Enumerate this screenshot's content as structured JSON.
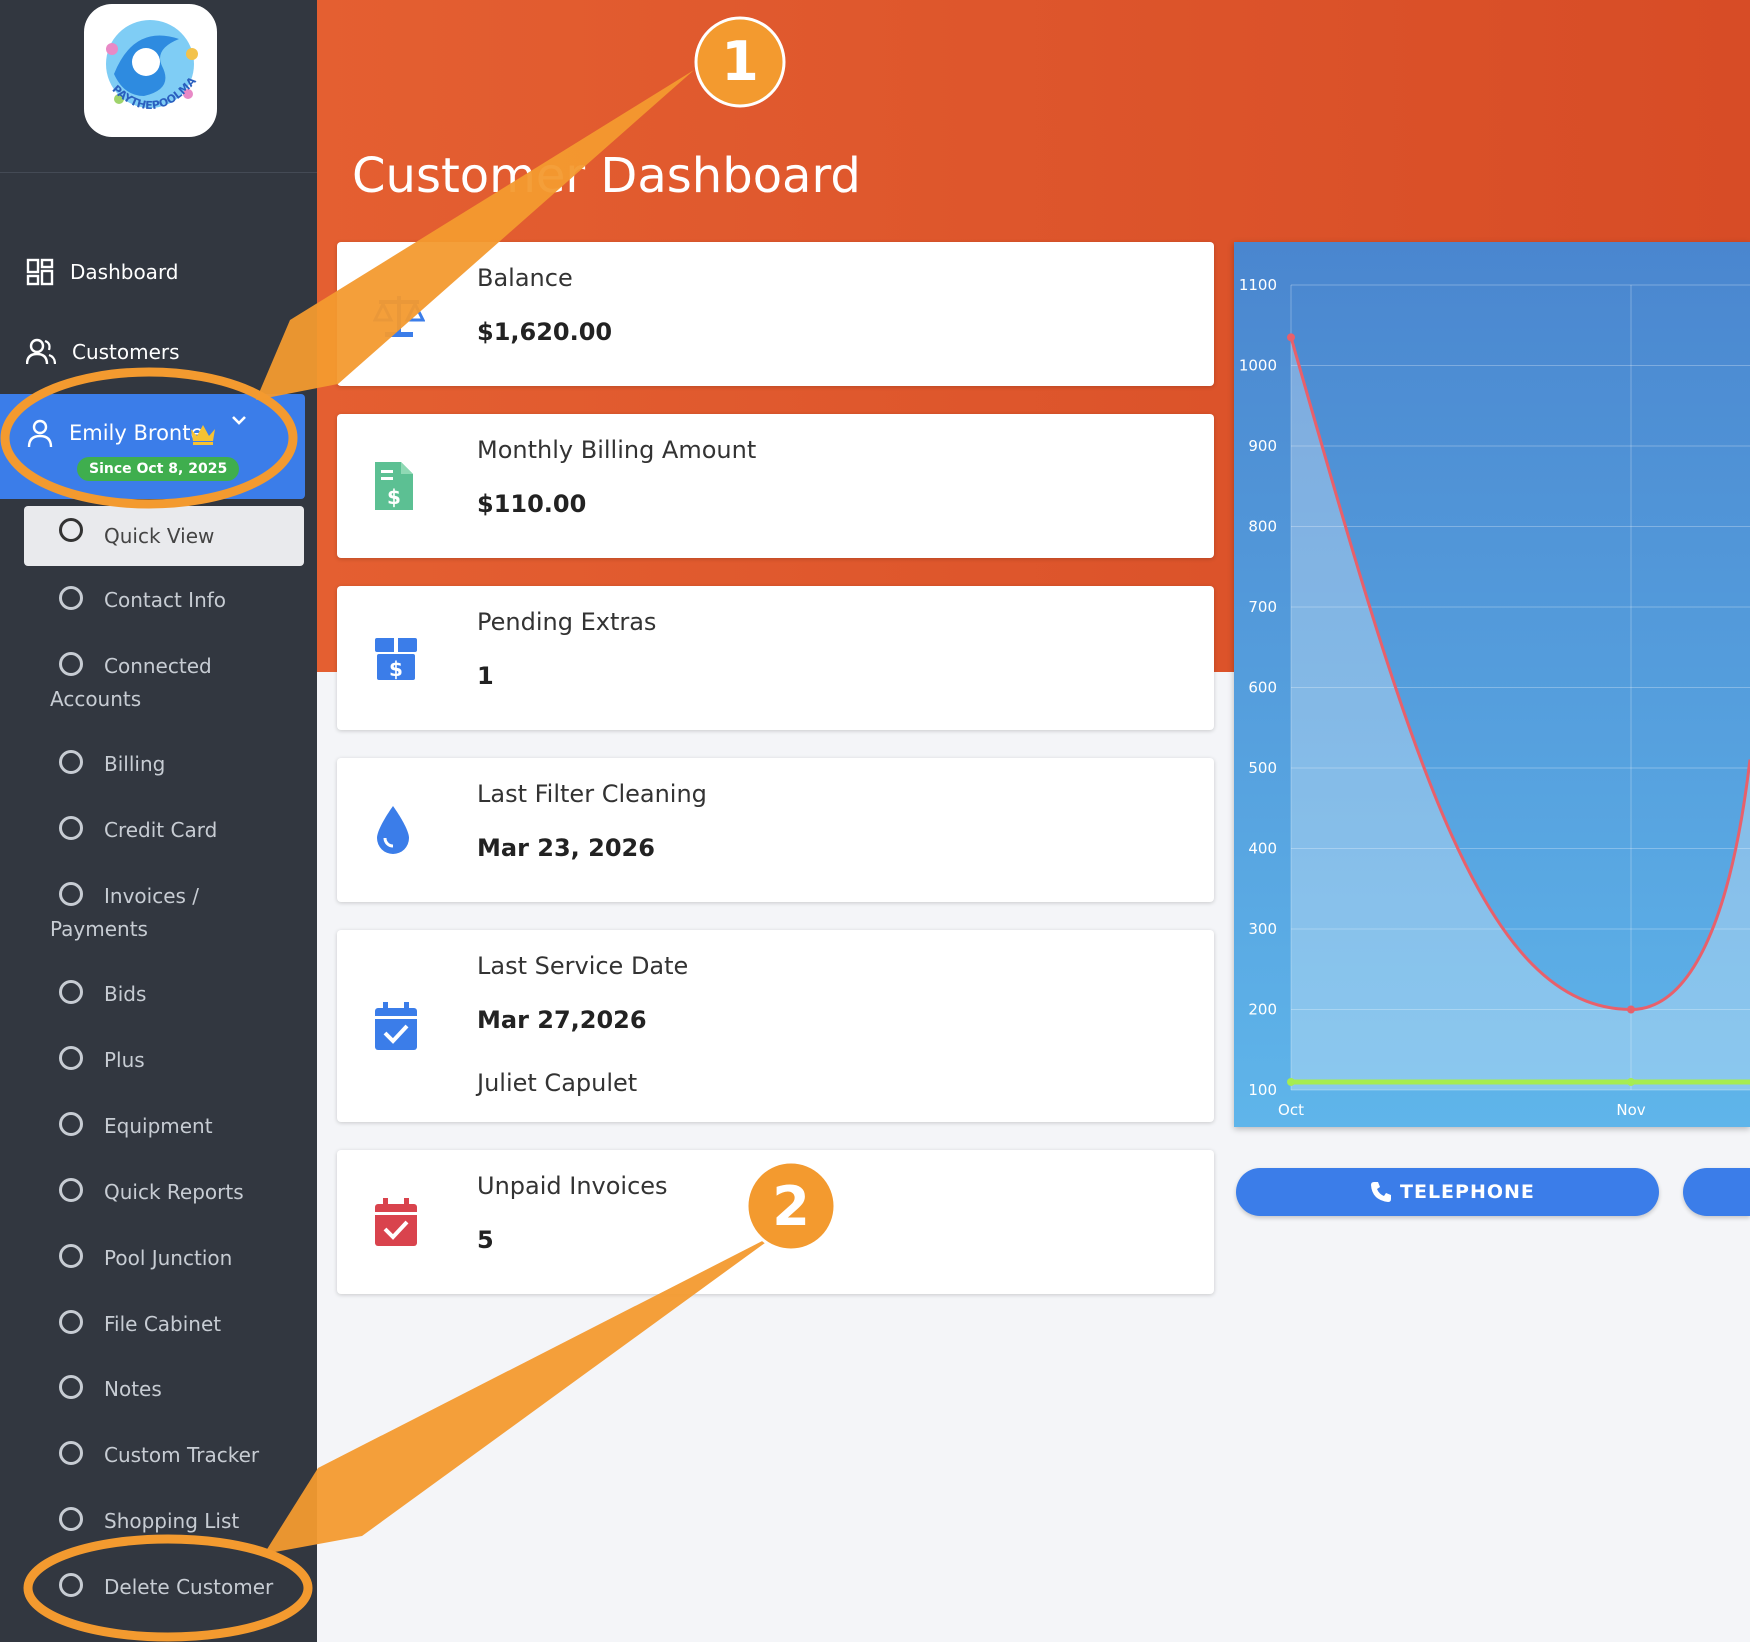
{
  "sidebar": {
    "logo_text": "PAYTHEPOOLMAN",
    "nav": [
      {
        "label": "Dashboard",
        "icon": "dashboard-grid-icon"
      },
      {
        "label": "Customers",
        "icon": "users-icon"
      }
    ],
    "customer": {
      "name": "Emily Bronte",
      "since": "Since Oct 8, 2025",
      "badge_icon": "crown-icon"
    },
    "menu": [
      {
        "label": "Quick View",
        "active": true
      },
      {
        "label": "Contact Info"
      },
      {
        "label": "Connected Accounts"
      },
      {
        "label": "Billing"
      },
      {
        "label": "Credit Card"
      },
      {
        "label": "Invoices / Payments"
      },
      {
        "label": "Bids"
      },
      {
        "label": "Plus"
      },
      {
        "label": "Equipment"
      },
      {
        "label": "Quick Reports"
      },
      {
        "label": "Pool Junction"
      },
      {
        "label": "File Cabinet"
      },
      {
        "label": "Notes"
      },
      {
        "label": "Custom Tracker"
      },
      {
        "label": "Shopping List"
      },
      {
        "label": "Delete Customer"
      }
    ]
  },
  "page": {
    "title": "Customer Dashboard"
  },
  "cards": [
    {
      "title": "Balance",
      "value": "$1,620.00",
      "icon": "scale-icon"
    },
    {
      "title": "Monthly Billing Amount",
      "value": "$110.00",
      "icon": "invoice-dollar-icon"
    },
    {
      "title": "Pending Extras",
      "value": "1",
      "icon": "box-dollar-icon"
    },
    {
      "title": "Last Filter Cleaning",
      "value": "Mar 23, 2026",
      "icon": "water-drop-icon"
    },
    {
      "title": "Last Service Date",
      "value": "Mar 27,2026",
      "sub": "Juliet Capulet",
      "icon": "calendar-check-icon"
    },
    {
      "title": "Unpaid Invoices",
      "value": "5",
      "icon": "calendar-check-red-icon"
    }
  ],
  "chart_data": {
    "type": "line",
    "categories": [
      "Oct",
      "Nov"
    ],
    "yticks": [
      100,
      200,
      300,
      400,
      500,
      600,
      700,
      800,
      900,
      1000,
      1100
    ],
    "ylim": [
      100,
      1100
    ],
    "series": [
      {
        "values": [
          1035,
          200
        ],
        "color": "#e8606b"
      },
      {
        "values": [
          110,
          110
        ],
        "color": "#a6ec52"
      }
    ]
  },
  "buttons": {
    "telephone": "TELEPHONE"
  },
  "annotations": {
    "callout_1": "1",
    "callout_2": "2"
  },
  "colors": {
    "sidebar": "#323740",
    "banner": "#e05a2e",
    "accent": "#3b7de9",
    "callout": "#f39a2f",
    "since_badge": "#3fae4e"
  }
}
